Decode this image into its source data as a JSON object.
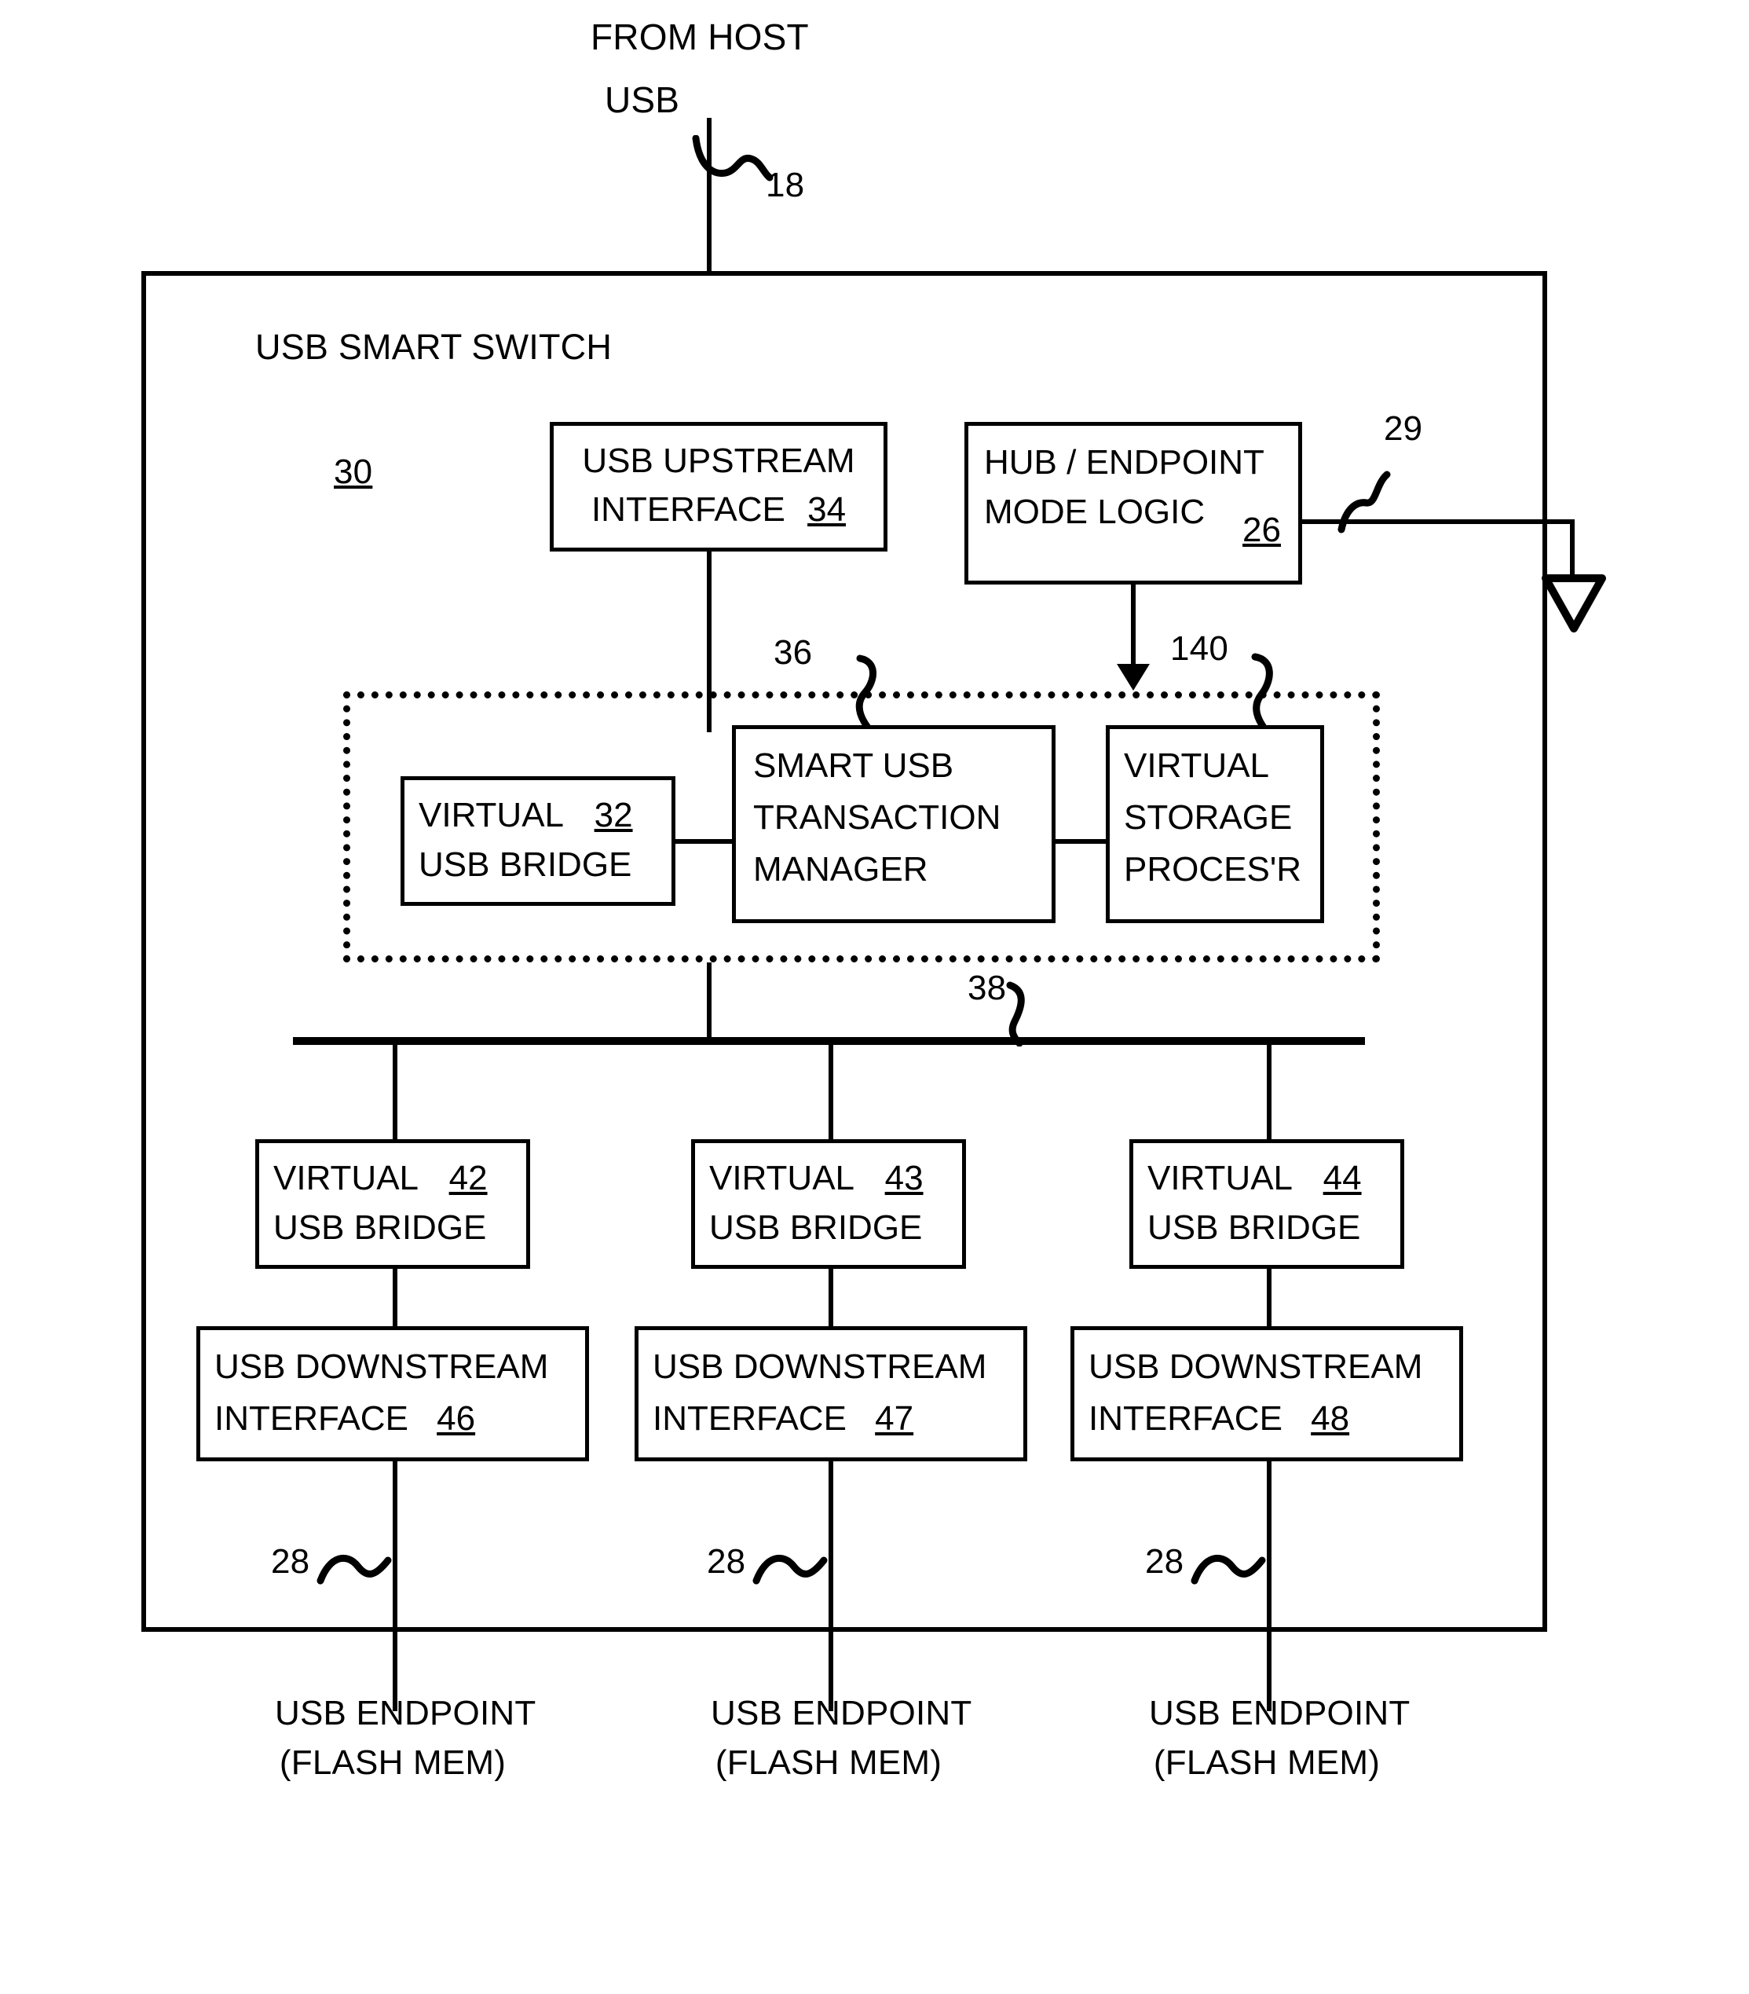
{
  "figure": {
    "title_text": "FROM HOST",
    "usb_label": "USB",
    "ref_18": "18",
    "chip_label": "USB SMART SWITCH",
    "ref_30": "30",
    "ref_29": "29",
    "ref_36": "36",
    "ref_140": "140",
    "ref_38": "38"
  },
  "boxes": {
    "upstream": {
      "line1": "USB UPSTREAM",
      "line2": "INTERFACE",
      "ref": "34"
    },
    "mode_logic": {
      "line1": "HUB / ENDPOINT",
      "line2": "MODE LOGIC",
      "ref": "26"
    },
    "virtual_bridge_top": {
      "line1": "VIRTUAL",
      "ref": "32",
      "line2": "USB BRIDGE"
    },
    "transaction_manager": {
      "line1": "SMART USB",
      "line2": "TRANSACTION",
      "line3": "MANAGER"
    },
    "storage_processor": {
      "line1": "VIRTUAL",
      "line2": "STORAGE",
      "line3": "PROCES'R"
    }
  },
  "columns": [
    {
      "bridge": {
        "line1": "VIRTUAL",
        "ref": "42",
        "line2": "USB BRIDGE"
      },
      "downstream": {
        "line1": "USB DOWNSTREAM",
        "line2": "INTERFACE",
        "ref": "46"
      },
      "link_ref": "28",
      "endpoint": {
        "line1": "USB ENDPOINT",
        "line2": "(FLASH MEM)"
      }
    },
    {
      "bridge": {
        "line1": "VIRTUAL",
        "ref": "43",
        "line2": "USB BRIDGE"
      },
      "downstream": {
        "line1": "USB DOWNSTREAM",
        "line2": "INTERFACE",
        "ref": "47"
      },
      "link_ref": "28",
      "endpoint": {
        "line1": "USB ENDPOINT",
        "line2": "(FLASH MEM)"
      }
    },
    {
      "bridge": {
        "line1": "VIRTUAL",
        "ref": "44",
        "line2": "USB BRIDGE"
      },
      "downstream": {
        "line1": "USB DOWNSTREAM",
        "line2": "INTERFACE",
        "ref": "48"
      },
      "link_ref": "28",
      "endpoint": {
        "line1": "USB ENDPOINT",
        "line2": "(FLASH MEM)"
      }
    }
  ],
  "colors": {
    "ink": "#000000",
    "paper": "#ffffff"
  }
}
